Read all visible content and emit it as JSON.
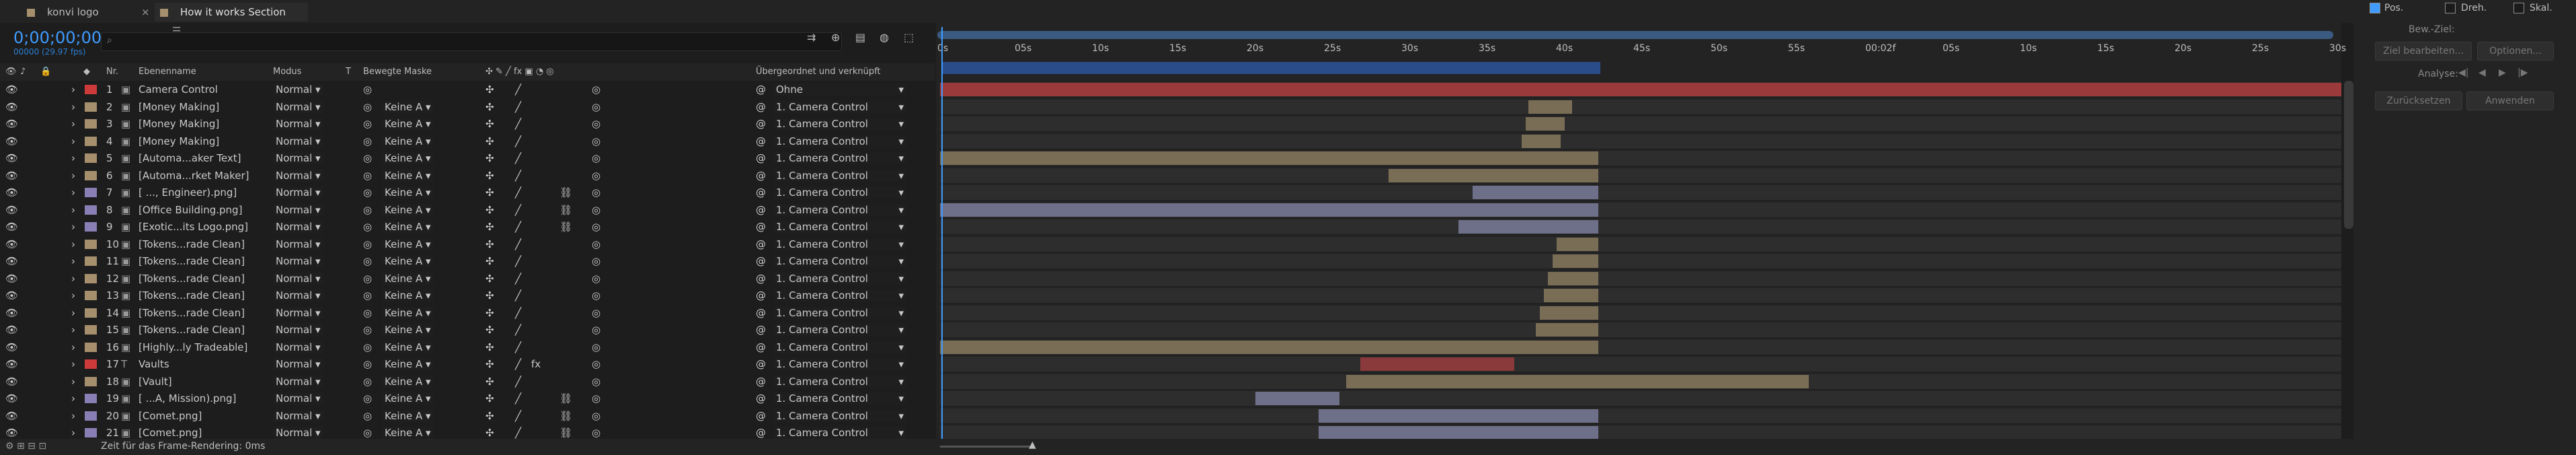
{
  "tabs": [
    {
      "label": "konvi logo",
      "active": false
    },
    {
      "label": "How it works Section",
      "active": true
    }
  ],
  "timecode": "0;00;00;00",
  "fps": "00000 (29.97 fps)",
  "search_placeholder": "",
  "columns": {
    "nr": "Nr.",
    "name": "Ebenenname",
    "mode": "Modus",
    "t": "T",
    "mask": "Bewegte Maske",
    "parent": "Übergeordnet und verknüpft"
  },
  "layers": [
    {
      "nr": "1",
      "name": "Camera Control",
      "mode": "Normal",
      "mask": "",
      "parent": "Ohne",
      "label_color": "#cc3a3a",
      "type": "null"
    },
    {
      "nr": "2",
      "name": "[Money Making]",
      "mode": "Normal",
      "mask": "Keine",
      "parent": "1. Camera Control",
      "label_color": "#a68f6d",
      "type": "comp"
    },
    {
      "nr": "3",
      "name": "[Money Making]",
      "mode": "Normal",
      "mask": "Keine",
      "parent": "1. Camera Control",
      "label_color": "#a68f6d",
      "type": "comp"
    },
    {
      "nr": "4",
      "name": "[Money Making]",
      "mode": "Normal",
      "mask": "Keine",
      "parent": "1. Camera Control",
      "label_color": "#a68f6d",
      "type": "comp"
    },
    {
      "nr": "5",
      "name": "[Automa...aker Text]",
      "mode": "Normal",
      "mask": "Keine",
      "parent": "1. Camera Control",
      "label_color": "#a68f6d",
      "type": "comp"
    },
    {
      "nr": "6",
      "name": "[Automa...rket Maker]",
      "mode": "Normal",
      "mask": "Keine",
      "parent": "1. Camera Control",
      "label_color": "#a68f6d",
      "type": "comp"
    },
    {
      "nr": "7",
      "name": "[ ..., Engineer).png]",
      "mode": "Normal",
      "mask": "Keine",
      "parent": "1. Camera Control",
      "label_color": "#8a7fb5",
      "type": "png"
    },
    {
      "nr": "8",
      "name": "[Office Building.png]",
      "mode": "Normal",
      "mask": "Keine",
      "parent": "1. Camera Control",
      "label_color": "#8a7fb5",
      "type": "png"
    },
    {
      "nr": "9",
      "name": "[Exotic...its Logo.png]",
      "mode": "Normal",
      "mask": "Keine",
      "parent": "1. Camera Control",
      "label_color": "#8a7fb5",
      "type": "png"
    },
    {
      "nr": "10",
      "name": "[Tokens...rade Clean]",
      "mode": "Normal",
      "mask": "Keine",
      "parent": "1. Camera Control",
      "label_color": "#a68f6d",
      "type": "comp"
    },
    {
      "nr": "11",
      "name": "[Tokens...rade Clean]",
      "mode": "Normal",
      "mask": "Keine",
      "parent": "1. Camera Control",
      "label_color": "#a68f6d",
      "type": "comp"
    },
    {
      "nr": "12",
      "name": "[Tokens...rade Clean]",
      "mode": "Normal",
      "mask": "Keine",
      "parent": "1. Camera Control",
      "label_color": "#a68f6d",
      "type": "comp"
    },
    {
      "nr": "13",
      "name": "[Tokens...rade Clean]",
      "mode": "Normal",
      "mask": "Keine",
      "parent": "1. Camera Control",
      "label_color": "#a68f6d",
      "type": "comp"
    },
    {
      "nr": "14",
      "name": "[Tokens...rade Clean]",
      "mode": "Normal",
      "mask": "Keine",
      "parent": "1. Camera Control",
      "label_color": "#a68f6d",
      "type": "comp"
    },
    {
      "nr": "15",
      "name": "[Tokens...rade Clean]",
      "mode": "Normal",
      "mask": "Keine",
      "parent": "1. Camera Control",
      "label_color": "#a68f6d",
      "type": "comp"
    },
    {
      "nr": "16",
      "name": "[Highly...ly Tradeable]",
      "mode": "Normal",
      "mask": "Keine",
      "parent": "1. Camera Control",
      "label_color": "#a68f6d",
      "type": "comp"
    },
    {
      "nr": "17",
      "name": "Vaults",
      "mode": "Normal",
      "mask": "Keine",
      "parent": "1. Camera Control",
      "label_color": "#cc3a3a",
      "type": "text"
    },
    {
      "nr": "18",
      "name": "[Vault]",
      "mode": "Normal",
      "mask": "Keine",
      "parent": "1. Camera Control",
      "label_color": "#a68f6d",
      "type": "comp"
    },
    {
      "nr": "19",
      "name": "[ ...A, Mission).png]",
      "mode": "Normal",
      "mask": "Keine",
      "parent": "1. Camera Control",
      "label_color": "#8a7fb5",
      "type": "png"
    },
    {
      "nr": "20",
      "name": "[Comet.png]",
      "mode": "Normal",
      "mask": "Keine",
      "parent": "1. Camera Control",
      "label_color": "#8a7fb5",
      "type": "png"
    },
    {
      "nr": "21",
      "name": "[Comet.png]",
      "mode": "Normal",
      "mask": "Keine",
      "parent": "1. Camera Control",
      "label_color": "#8a7fb5",
      "type": "png"
    }
  ],
  "ruler_ticks": [
    "0s",
    "05s",
    "10s",
    "15s",
    "20s",
    "25s",
    "30s",
    "35s",
    "40s",
    "45s",
    "50s",
    "55s",
    "00:02f",
    "05s",
    "10s",
    "15s",
    "20s",
    "25s",
    "30s"
  ],
  "layer_bars": [
    {
      "start": 0.0,
      "end": 1.0,
      "color": "#9b3a3a"
    },
    {
      "start": 0.42,
      "end": 0.451,
      "color": "#7a6d55"
    },
    {
      "start": 0.418,
      "end": 0.446,
      "color": "#7a6d55"
    },
    {
      "start": 0.415,
      "end": 0.443,
      "color": "#7a6d55"
    },
    {
      "start": 0.0,
      "end": 0.47,
      "color": "#7a6d55"
    },
    {
      "start": 0.32,
      "end": 0.47,
      "color": "#7a6d55"
    },
    {
      "start": 0.38,
      "end": 0.47,
      "color": "#6e6f88"
    },
    {
      "start": 0.0,
      "end": 0.47,
      "color": "#6e6f88"
    },
    {
      "start": 0.37,
      "end": 0.47,
      "color": "#6e6f88"
    },
    {
      "start": 0.44,
      "end": 0.47,
      "color": "#7a6d55"
    },
    {
      "start": 0.437,
      "end": 0.47,
      "color": "#7a6d55"
    },
    {
      "start": 0.434,
      "end": 0.47,
      "color": "#7a6d55"
    },
    {
      "start": 0.431,
      "end": 0.47,
      "color": "#7a6d55"
    },
    {
      "start": 0.428,
      "end": 0.47,
      "color": "#7a6d55"
    },
    {
      "start": 0.425,
      "end": 0.47,
      "color": "#7a6d55"
    },
    {
      "start": 0.0,
      "end": 0.47,
      "color": "#7a6d55"
    },
    {
      "start": 0.3,
      "end": 0.41,
      "color": "#8a3a3a"
    },
    {
      "start": 0.29,
      "end": 0.62,
      "color": "#7a6d55"
    },
    {
      "start": 0.225,
      "end": 0.285,
      "color": "#6e6f88"
    },
    {
      "start": 0.27,
      "end": 0.47,
      "color": "#6e6f88"
    },
    {
      "start": 0.27,
      "end": 0.47,
      "color": "#6e6f88"
    }
  ],
  "right_panel": {
    "pos": "Pos.",
    "dreh": "Dreh.",
    "skal": "Skal.",
    "bew_ziel": "Bew.-Ziel:",
    "ziel": "Ziel bearbeiten...",
    "optionen": "Optionen...",
    "analyse": "Analyse:",
    "zuruecksetzen": "Zurücksetzen",
    "anwenden": "Anwenden"
  },
  "footer": {
    "render_time": "Zeit für das Frame-Rendering: 0ms"
  }
}
